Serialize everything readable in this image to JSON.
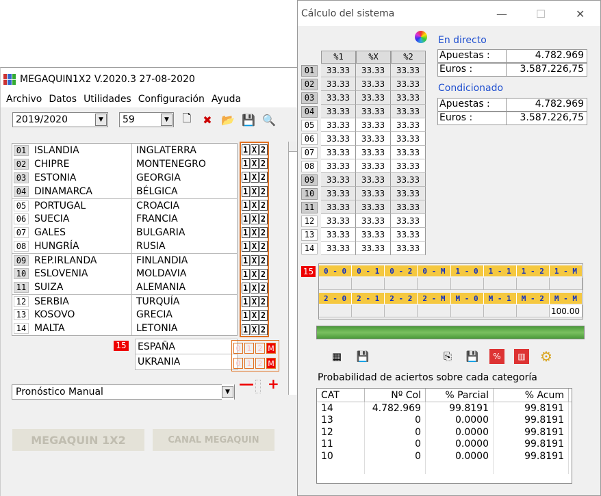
{
  "main": {
    "title": "MEGAQUIN1X2  V.2020.3 27-08-2020",
    "menu": [
      "Archivo",
      "Datos",
      "Utilidades",
      "Configuración",
      "Ayuda"
    ],
    "season": "2019/2020",
    "jornada": "59",
    "matches": [
      {
        "n": "01",
        "home": "ISLANDIA",
        "away": "INGLATERRA"
      },
      {
        "n": "02",
        "home": "CHIPRE",
        "away": "MONTENEGRO"
      },
      {
        "n": "03",
        "home": "ESTONIA",
        "away": "GEORGIA"
      },
      {
        "n": "04",
        "home": "DINAMARCA",
        "away": "BÉLGICA"
      },
      {
        "n": "05",
        "home": "PORTUGAL",
        "away": "CROACIA"
      },
      {
        "n": "06",
        "home": "SUECIA",
        "away": "FRANCIA"
      },
      {
        "n": "07",
        "home": "GALES",
        "away": "BULGARIA"
      },
      {
        "n": "08",
        "home": "HUNGRÍA",
        "away": "RUSIA"
      },
      {
        "n": "09",
        "home": "REP.IRLANDA",
        "away": "FINLANDIA"
      },
      {
        "n": "10",
        "home": "ESLOVENIA",
        "away": "MOLDAVIA"
      },
      {
        "n": "11",
        "home": "SUIZA",
        "away": "ALEMANIA"
      },
      {
        "n": "12",
        "home": "SERBIA",
        "away": "TURQUÍA"
      },
      {
        "n": "13",
        "home": "KOSOVO",
        "away": "GRECIA"
      },
      {
        "n": "14",
        "home": "MALTA",
        "away": "LETONIA"
      }
    ],
    "sign_labels": [
      "1",
      "X",
      "2"
    ],
    "pleno": {
      "n": "15",
      "home": "ESPAÑA",
      "away": "UKRANIA",
      "opts": [
        "0",
        "1",
        "2",
        "M"
      ]
    },
    "pronostico": "Pronóstico Manual",
    "btn_megaquin": "MEGAQUIN 1X2",
    "btn_canal": "CANAL MEGAQUIN"
  },
  "dialog": {
    "title": "Cálculo del sistema",
    "headers": [
      "%1",
      "%X",
      "%2"
    ],
    "rows": [
      [
        "01",
        "33.33",
        "33.33",
        "33.33"
      ],
      [
        "02",
        "33.33",
        "33.33",
        "33.33"
      ],
      [
        "03",
        "33.33",
        "33.33",
        "33.33"
      ],
      [
        "04",
        "33.33",
        "33.33",
        "33.33"
      ],
      [
        "05",
        "33.33",
        "33.33",
        "33.33"
      ],
      [
        "06",
        "33.33",
        "33.33",
        "33.33"
      ],
      [
        "07",
        "33.33",
        "33.33",
        "33.33"
      ],
      [
        "08",
        "33.33",
        "33.33",
        "33.33"
      ],
      [
        "09",
        "33.33",
        "33.33",
        "33.33"
      ],
      [
        "10",
        "33.33",
        "33.33",
        "33.33"
      ],
      [
        "11",
        "33.33",
        "33.33",
        "33.33"
      ],
      [
        "12",
        "33.33",
        "33.33",
        "33.33"
      ],
      [
        "13",
        "33.33",
        "33.33",
        "33.33"
      ],
      [
        "14",
        "33.33",
        "33.33",
        "33.33"
      ]
    ],
    "en_directo": {
      "label": "En directo",
      "apuestas_k": "Apuestas :",
      "apuestas_v": "4.782.969",
      "euros_k": "Euros :",
      "euros_v": "3.587.226,75"
    },
    "condicionado": {
      "label": "Condicionado",
      "apuestas_k": "Apuestas :",
      "apuestas_v": "4.782.969",
      "euros_k": "Euros :",
      "euros_v": "3.587.226,75"
    },
    "p15": "15",
    "goals_top": [
      "0 - 0",
      "0 - 1",
      "0 - 2",
      "0 - M",
      "1 - 0",
      "1 - 1",
      "1 - 2",
      "1 - M"
    ],
    "goals_bottom": [
      "2 - 0",
      "2 - 1",
      "2 - 2",
      "2 - M",
      "M - 0",
      "M - 1",
      "M - 2",
      "M - M"
    ],
    "goals_last_value": "100.00",
    "prob_title": "Probabilidad de aciertos sobre cada categoría",
    "cat_headers": [
      "CAT",
      "Nº Col",
      "% Parcial",
      "% Acum"
    ],
    "cat_rows": [
      [
        "14",
        "4.782.969",
        "99.8191",
        "99.8191"
      ],
      [
        "13",
        "0",
        "0.0000",
        "99.8191"
      ],
      [
        "12",
        "0",
        "0.0000",
        "99.8191"
      ],
      [
        "11",
        "0",
        "0.0000",
        "99.8191"
      ],
      [
        "10",
        "0",
        "0.0000",
        "99.8191"
      ]
    ]
  }
}
